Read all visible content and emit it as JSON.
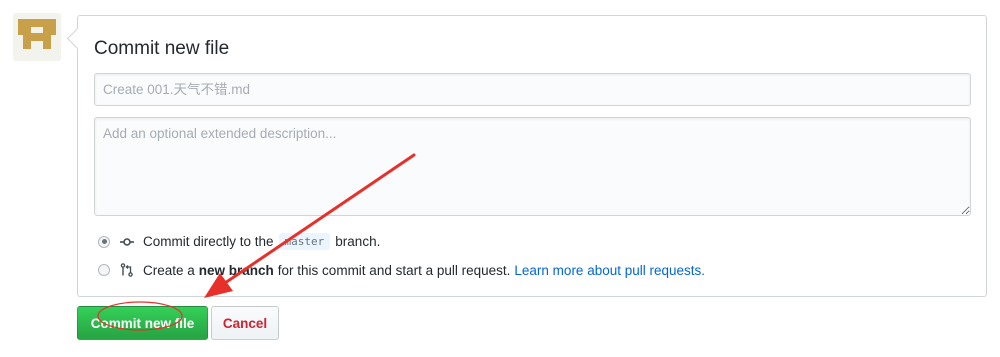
{
  "commit_form": {
    "title": "Commit new file",
    "summary_placeholder": "Create 001.天气不错.md",
    "summary_value": "",
    "description_placeholder": "Add an optional extended description...",
    "description_value": ""
  },
  "options": {
    "direct": {
      "selected": true,
      "prefix": "Commit directly to the",
      "branch": "master",
      "suffix": "branch."
    },
    "new_branch": {
      "selected": false,
      "prefix": "Create a",
      "bold": "new branch",
      "suffix": "for this commit and start a pull request.",
      "link": "Learn more about pull requests."
    }
  },
  "buttons": {
    "commit_label": "Commit new file",
    "cancel_label": "Cancel"
  },
  "colors": {
    "commit_button": "#28a745",
    "cancel_text": "#cb2431",
    "link": "#0366d6",
    "annotation_arrow": "#e8302a",
    "avatar_mark": "#c8a04a"
  },
  "icons": {
    "avatar": "identicon",
    "direct_commit": "git-commit-icon",
    "new_branch": "git-pull-request-icon"
  }
}
